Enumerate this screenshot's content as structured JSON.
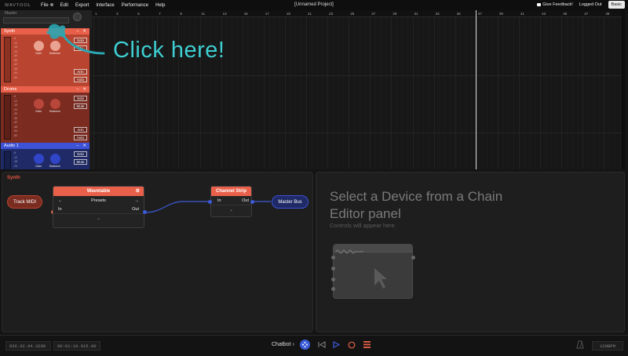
{
  "app": {
    "logo": "WAVTOOL",
    "project_title": "[Unnamed Project]"
  },
  "menu": {
    "items": [
      "File",
      "Edit",
      "Export",
      "Interface",
      "Performance",
      "Help"
    ],
    "feedback": "Give Feedback!",
    "login_status": "Logged Out",
    "mode": "Basic"
  },
  "master": {
    "label": "Master"
  },
  "tracks": [
    {
      "name": "Synth",
      "color": "#e8604a",
      "body_color": "#b9442f",
      "knob_color": "#e9a390",
      "gain": "Gain",
      "balance": "Balance",
      "solo": "Solo",
      "mute": "Mu",
      "arm": "Arm",
      "auto": "Auto"
    },
    {
      "name": "Drums",
      "color": "#e8604a",
      "body_color": "#7c2b20",
      "knob_color": "#b8463a",
      "gain": "Gain",
      "balance": "Balance",
      "solo": "Solo",
      "mute": "Mute",
      "arm": "Arm",
      "auto": "Auto"
    },
    {
      "name": "Audio 1",
      "color": "#3d52d6",
      "body_color": "#1f2a66",
      "knob_color": "#3045c8",
      "gain": "Gain",
      "balance": "Balance",
      "solo": "Solo",
      "mute": "Mute"
    }
  ],
  "meter_ticks": [
    "-6",
    "-12",
    "-18",
    "-24",
    "-30",
    "-36",
    "-42",
    "-48",
    "-54",
    "-60"
  ],
  "ruler": [
    "1",
    "3",
    "5",
    "7",
    "9",
    "11",
    "13",
    "15",
    "17",
    "19",
    "21",
    "23",
    "25",
    "27",
    "29",
    "31",
    "33",
    "35",
    "37",
    "39",
    "41",
    "43",
    "45",
    "47",
    "49"
  ],
  "hint": {
    "text": "Click here!",
    "color": "#3ecfd3"
  },
  "chain_editor": {
    "title": "Synth",
    "track_midi": "Track MIDI",
    "wavetable": {
      "title": "Wavetable",
      "presets": "Presets",
      "in": "In",
      "out": "Out"
    },
    "channel_strip": {
      "title": "Channel Strip",
      "in": "In",
      "out": "Out"
    },
    "master_bus": "Master Bus"
  },
  "device_panel": {
    "title": "Select a Device from a Chain Editor panel",
    "subtitle": "Controls will appear here"
  },
  "transport": {
    "position_bars": "036.02.04.3200",
    "position_time": "00:01:10.915.00",
    "chatbot": "Chatbot",
    "tempo": "120BPM"
  },
  "colors": {
    "accent": "#e8604a",
    "blue": "#3d52d6",
    "link": "#3b5bd8",
    "record": "#e8604a"
  }
}
